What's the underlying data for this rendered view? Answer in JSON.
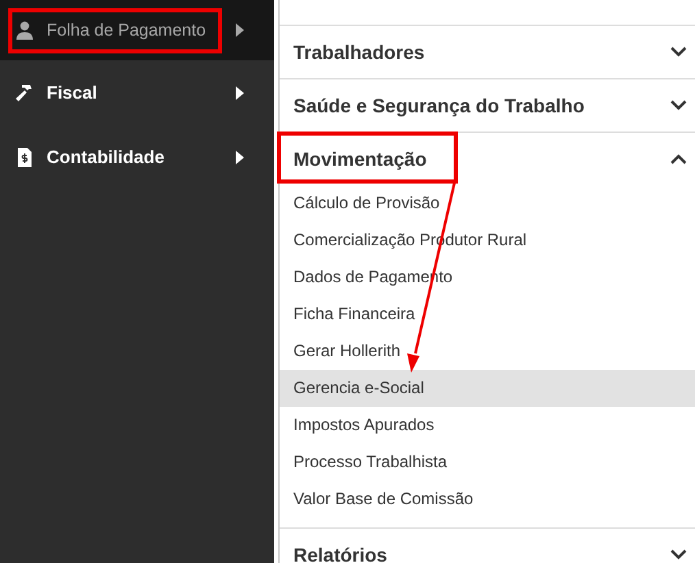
{
  "sidebar": {
    "items": [
      {
        "label": "Folha de Pagamento",
        "selected": true,
        "marked": true
      },
      {
        "label": "Fiscal",
        "selected": false,
        "marked": false
      },
      {
        "label": "Contabilidade",
        "selected": false,
        "marked": false
      }
    ]
  },
  "menu": {
    "sections": [
      {
        "title": "Trabalhadores",
        "expanded": false,
        "marked": false
      },
      {
        "title": "Saúde e Segurança do Trabalho",
        "expanded": false,
        "marked": false
      },
      {
        "title": "Movimentação",
        "expanded": true,
        "marked": true,
        "items": [
          {
            "label": "Cálculo de Provisão",
            "selected": false
          },
          {
            "label": "Comercialização Produtor Rural",
            "selected": false
          },
          {
            "label": "Dados de Pagamento",
            "selected": false
          },
          {
            "label": "Ficha Financeira",
            "selected": false
          },
          {
            "label": "Gerar Hollerith",
            "selected": false
          },
          {
            "label": "Gerencia e-Social",
            "selected": true,
            "pointed": true
          },
          {
            "label": "Impostos Apurados",
            "selected": false
          },
          {
            "label": "Processo Trabalhista",
            "selected": false
          },
          {
            "label": "Valor Base de Comissão",
            "selected": false
          }
        ]
      },
      {
        "title": "Relatórios",
        "expanded": false,
        "marked": false
      }
    ]
  }
}
